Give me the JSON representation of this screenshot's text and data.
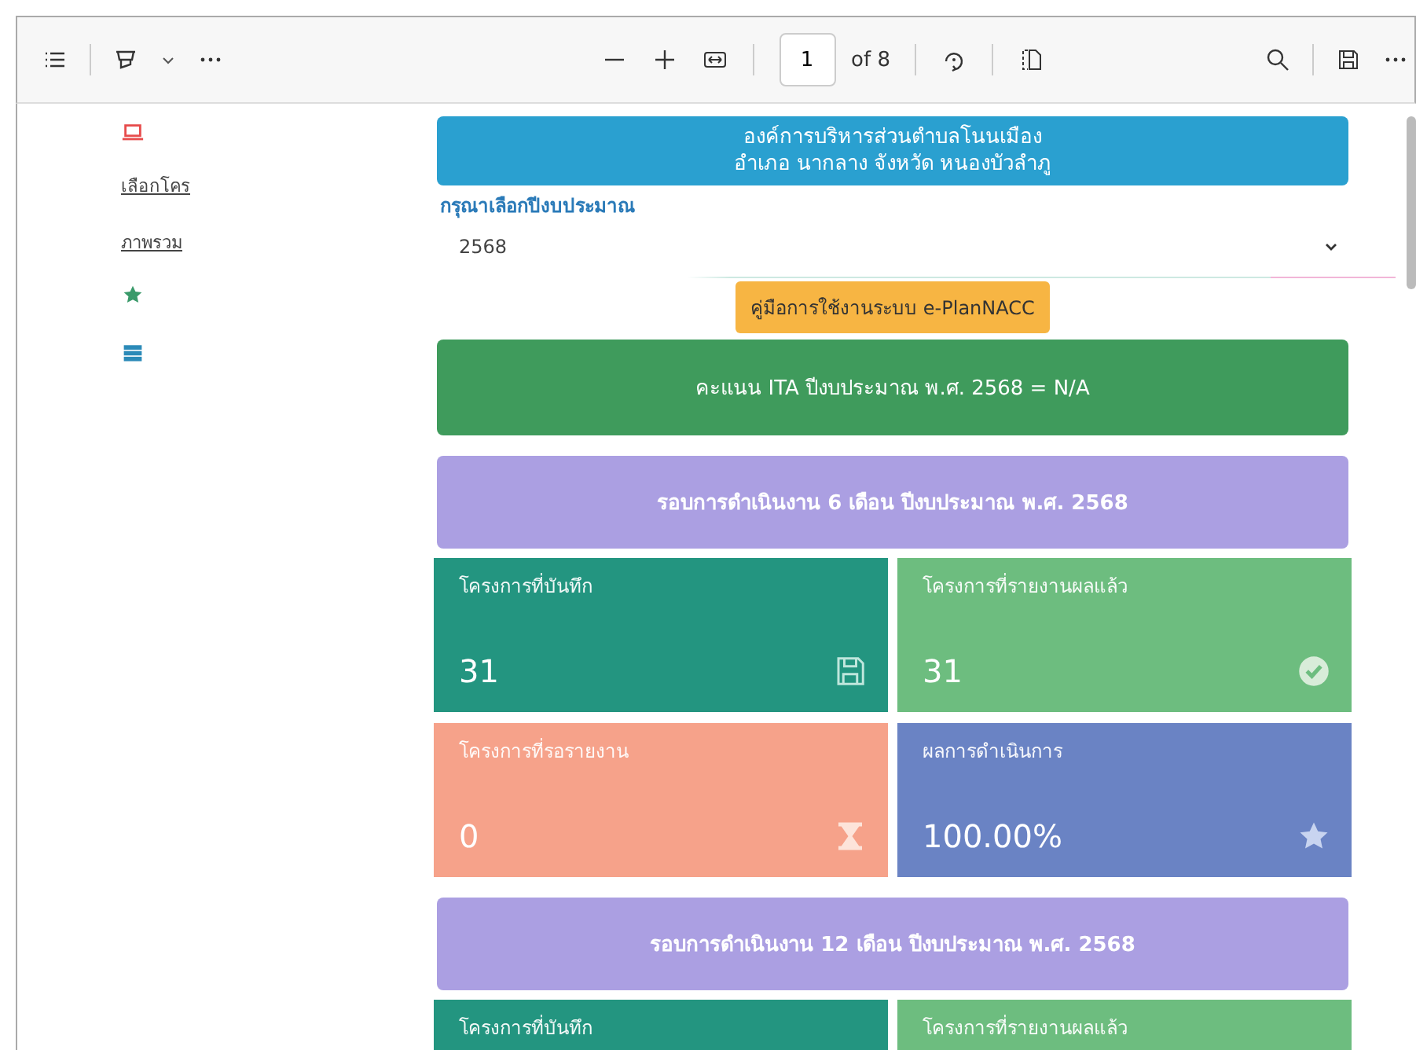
{
  "toolbar": {
    "page_number": "1",
    "page_count": "of 8"
  },
  "sidebar": {
    "links": [
      "เลือกโคร",
      "ภาพรวม"
    ]
  },
  "banner": {
    "lines": [
      "องค์การบริหารส่วนตำบลโนนเมือง",
      "อำเภอ นากลาง จังหวัด หนองบัวลำภู"
    ]
  },
  "budget_year": {
    "label": "กรุณาเลือกปีงบประมาณ",
    "value": "2568"
  },
  "manual_button": "คู่มือการใช้งานระบบ e-PlanNACC",
  "ita_score": "คะแนน ITA ปีงบประมาณ พ.ศ. 2568 = N/A",
  "sections": [
    {
      "title": "รอบการดำเนินงาน 6 เดือน ปีงบประมาณ พ.ศ. 2568",
      "cards": [
        {
          "kind": "recorded",
          "label": "โครงการที่บันทึก",
          "value": "31"
        },
        {
          "kind": "reported",
          "label": "โครงการที่รายงานผลแล้ว",
          "value": "31"
        },
        {
          "kind": "pending",
          "label": "โครงการที่รอรายงาน",
          "value": "0"
        },
        {
          "kind": "result",
          "label": "ผลการดำเนินการ",
          "value": "100.00%"
        }
      ]
    },
    {
      "title": "รอบการดำเนินงาน 12 เดือน ปีงบประมาณ พ.ศ. 2568",
      "cards": [
        {
          "kind": "recorded",
          "label": "โครงการที่บันทึก"
        },
        {
          "kind": "reported",
          "label": "โครงการที่รายงานผลแล้ว"
        }
      ]
    }
  ]
}
